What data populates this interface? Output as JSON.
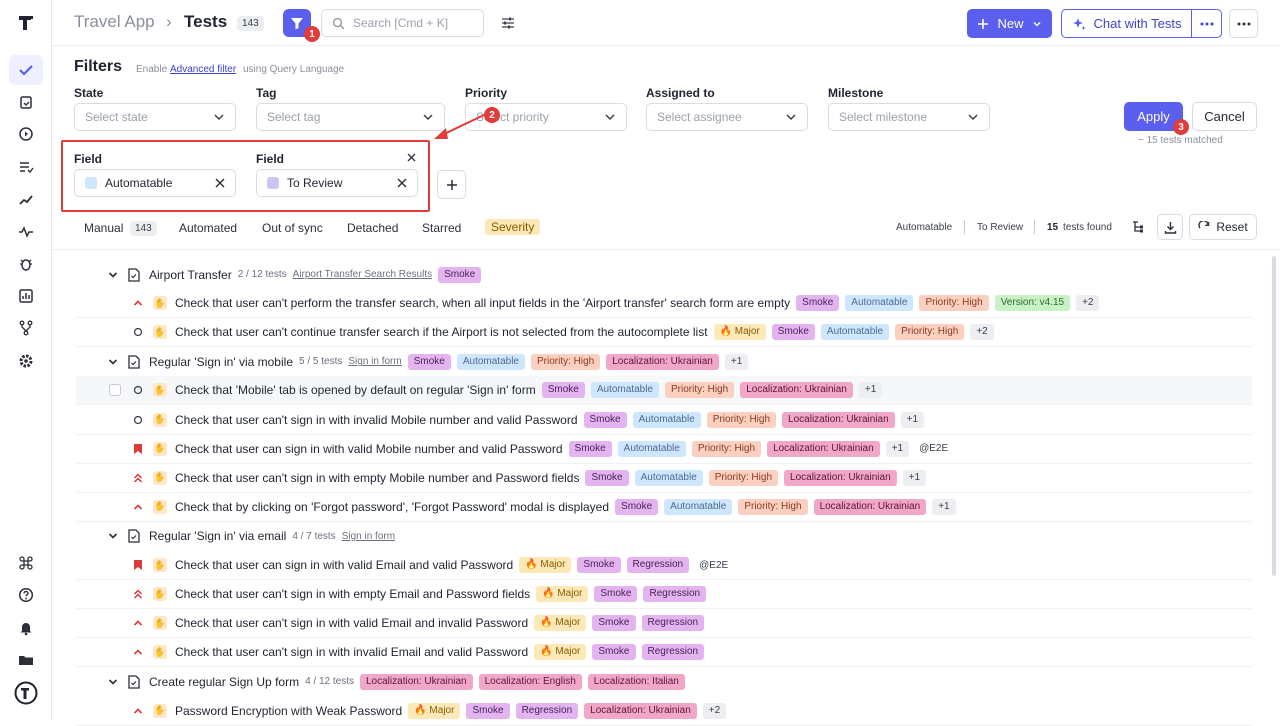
{
  "header": {
    "app": "Travel App",
    "sep": "›",
    "page": "Tests",
    "count": "143",
    "badge1": "1",
    "search_placeholder": "Search [Cmd + K]",
    "new_label": "New",
    "chat_label": "Chat with Tests"
  },
  "filters": {
    "title": "Filters",
    "enable_text": "Enable",
    "advanced_link": "Advanced filter",
    "advanced_suffix": "using Query Language",
    "state": {
      "label": "State",
      "placeholder": "Select state"
    },
    "tag": {
      "label": "Tag",
      "placeholder": "Select tag"
    },
    "priority": {
      "label": "Priority",
      "placeholder": "Select priority"
    },
    "assigned": {
      "label": "Assigned to",
      "placeholder": "Select assignee"
    },
    "milestone": {
      "label": "Milestone",
      "placeholder": "Select milestone"
    },
    "field1": {
      "label": "Field",
      "value": "Automatable",
      "color": "#cfe6ff"
    },
    "field2": {
      "label": "Field",
      "value": "To Review",
      "color": "#c9c6f5"
    },
    "apply": "Apply",
    "cancel": "Cancel",
    "matched": "~ 15 tests matched",
    "badge2": "2",
    "badge3": "3"
  },
  "tabs": {
    "manual": "Manual",
    "manual_count": "143",
    "automated": "Automated",
    "out_of_sync": "Out of sync",
    "detached": "Detached",
    "starred": "Starred",
    "severity": "Severity"
  },
  "summary": {
    "f1": "Automatable",
    "f2": "To Review",
    "found_num": "15",
    "found_text": "tests found",
    "reset": "Reset"
  },
  "tag_colors": {
    "Smoke": [
      "#e4b4f0",
      "#4a1f57"
    ],
    "Automatable": [
      "#cfe6ff",
      "#4b6b8f"
    ],
    "Priority: High": [
      "#fbd0c0",
      "#8a3a1f"
    ],
    "Version: v4.15": [
      "#c8f2c6",
      "#2f6b2c"
    ],
    "Localization: Ukrainian": [
      "#f0a7c8",
      "#5e1537"
    ],
    "Localization: English": [
      "#f0a7c8",
      "#5e1537"
    ],
    "Localization: Italian": [
      "#f0a7c8",
      "#5e1537"
    ],
    "Regression": [
      "#e4b4f0",
      "#4a1f57"
    ],
    "🔥 Major": [
      "#fde9b8",
      "#8a5a00"
    ],
    "+1": [
      "#eceef2",
      "#3a3f4b"
    ],
    "+2": [
      "#eceef2",
      "#3a3f4b"
    ]
  },
  "rows": [
    {
      "type": "suite",
      "title": "Airport Transfer",
      "sub": "2 / 12 tests",
      "link": "Airport Transfer Search Results",
      "tags": [
        "Smoke"
      ]
    },
    {
      "type": "test",
      "prio": "up",
      "title": "Check that user can't perform the transfer search, when all input fields in the 'Airport transfer' search form are empty",
      "tags": [
        "Smoke",
        "Automatable",
        "Priority: High",
        "Version: v4.15",
        "+2"
      ]
    },
    {
      "type": "test",
      "prio": "circle",
      "title": "Check that user can't continue transfer search if the Airport is not selected from the autocomplete list",
      "tags": [
        "🔥 Major",
        "Smoke",
        "Automatable",
        "Priority: High",
        "+2"
      ]
    },
    {
      "type": "suite",
      "title": "Regular 'Sign in' via mobile",
      "sub": "5 / 5 tests",
      "link": "Sign in form",
      "tags": [
        "Smoke",
        "Automatable",
        "Priority: High",
        "Localization: Ukrainian",
        "+1"
      ]
    },
    {
      "type": "test",
      "prio": "circle",
      "hover": true,
      "title": "Check that 'Mobile' tab is opened by default on regular 'Sign in' form",
      "tags": [
        "Smoke",
        "Automatable",
        "Priority: High",
        "Localization: Ukrainian",
        "+1"
      ]
    },
    {
      "type": "test",
      "prio": "circle",
      "title": "Check that user can't sign in with invalid Mobile number and valid Password",
      "tags": [
        "Smoke",
        "Automatable",
        "Priority: High",
        "Localization: Ukrainian",
        "+1"
      ]
    },
    {
      "type": "test",
      "prio": "flag",
      "title": "Check that user can sign in with valid Mobile number and valid Password",
      "tags": [
        "Smoke",
        "Automatable",
        "Priority: High",
        "Localization: Ukrainian",
        "+1"
      ],
      "extra": "@E2E"
    },
    {
      "type": "test",
      "prio": "double",
      "title": "Check that user can't sign in with empty Mobile number and Password fields",
      "tags": [
        "Smoke",
        "Automatable",
        "Priority: High",
        "Localization: Ukrainian",
        "+1"
      ]
    },
    {
      "type": "test",
      "prio": "up",
      "title": "Check that by clicking on 'Forgot password', 'Forgot Password' modal is displayed",
      "tags": [
        "Smoke",
        "Automatable",
        "Priority: High",
        "Localization: Ukrainian",
        "+1"
      ]
    },
    {
      "type": "suite",
      "title": "Regular 'Sign in' via email",
      "sub": "4 / 7 tests",
      "link": "Sign in form",
      "tags": []
    },
    {
      "type": "test",
      "prio": "flag",
      "title": "Check that user can sign in with valid Email and valid Password",
      "tags": [
        "🔥 Major",
        "Smoke",
        "Regression"
      ],
      "extra": "@E2E"
    },
    {
      "type": "test",
      "prio": "double",
      "title": "Check that user can't sign in with empty Email and Password fields",
      "tags": [
        "🔥 Major",
        "Smoke",
        "Regression"
      ]
    },
    {
      "type": "test",
      "prio": "up",
      "title": "Check that user can't sign in with valid Email and invalid Password",
      "tags": [
        "🔥 Major",
        "Smoke",
        "Regression"
      ]
    },
    {
      "type": "test",
      "prio": "up",
      "title": "Check that user can't sign in with invalid Email and valid Password",
      "tags": [
        "🔥 Major",
        "Smoke",
        "Regression"
      ]
    },
    {
      "type": "suite",
      "title": "Create regular Sign Up form",
      "sub": "4 / 12 tests",
      "link": "",
      "tags": [
        "Localization: Ukrainian",
        "Localization: English",
        "Localization: Italian"
      ]
    },
    {
      "type": "test",
      "prio": "up",
      "title": "Password Encryption with Weak Password",
      "tags": [
        "🔥 Major",
        "Smoke",
        "Regression",
        "Localization: Ukrainian",
        "+2"
      ]
    }
  ]
}
